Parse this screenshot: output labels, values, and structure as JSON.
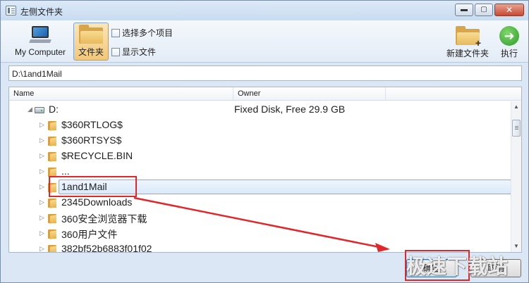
{
  "window": {
    "title": "左侧文件夹",
    "buttons": {
      "minimize": "▬",
      "maximize": "▢",
      "close": "✕"
    }
  },
  "toolbar": {
    "my_computer": "My Computer",
    "folder": "文件夹",
    "select_multiple": "选择多个项目",
    "show_files": "显示文件",
    "new_folder": "新建文件夹",
    "execute": "执行"
  },
  "path": {
    "value": "D:\\1and1Mail"
  },
  "list": {
    "columns": [
      "Name",
      "Owner"
    ],
    "drive": {
      "label": "D:",
      "owner": "Fixed Disk, Free 29.9 GB"
    },
    "folders": [
      {
        "name": "$360RTLOG$"
      },
      {
        "name": "$360RTSYS$"
      },
      {
        "name": "$RECYCLE.BIN"
      },
      {
        "name": "..."
      },
      {
        "name": "1and1Mail",
        "selected": true
      },
      {
        "name": "2345Downloads"
      },
      {
        "name": "360安全浏览器下载"
      },
      {
        "name": "360用户文件"
      },
      {
        "name": "382bf52b6883f01f02"
      }
    ]
  },
  "footer": {
    "ok_label": "确定",
    "cancel_label": "取消"
  },
  "watermark": {
    "text": "极速下载站"
  },
  "colors": {
    "annotation": "#e0272b",
    "selection_border": "#84acdd",
    "window_bg": "#dbe7f4"
  }
}
